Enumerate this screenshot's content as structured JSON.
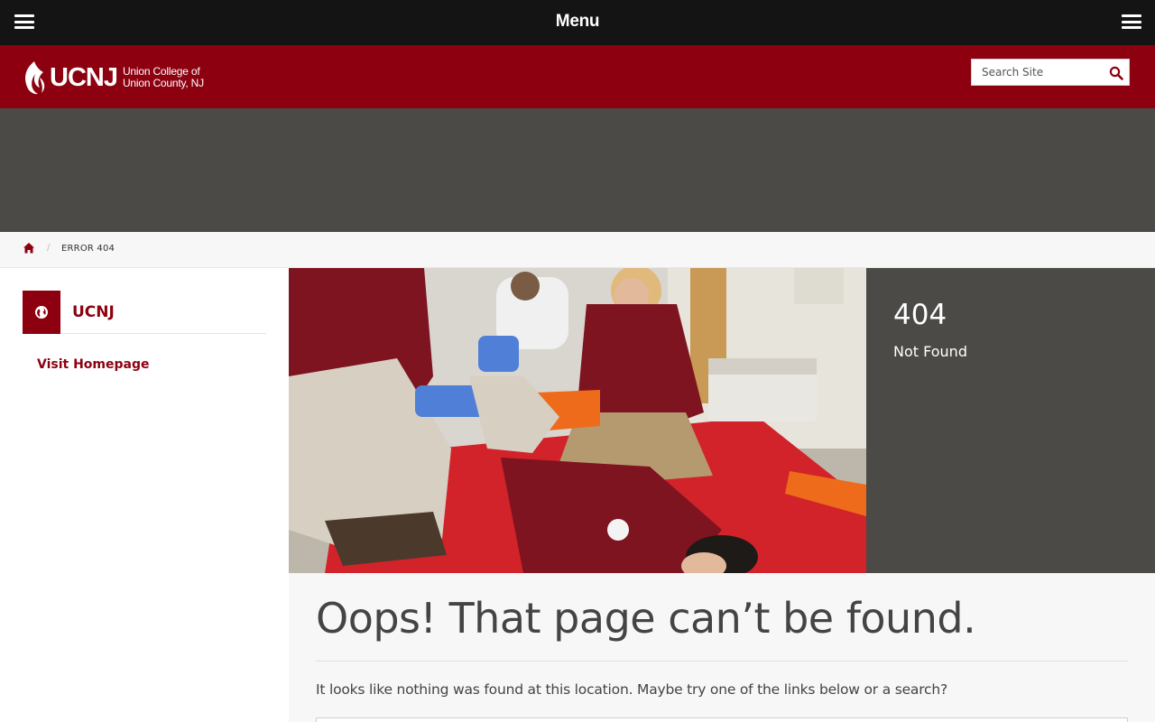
{
  "topbar": {
    "title": "Menu"
  },
  "brand": {
    "name": "UCNJ",
    "subtitle_line1": "Union College of",
    "subtitle_line2": "Union County, NJ"
  },
  "search": {
    "placeholder": "Search Site"
  },
  "breadcrumb": {
    "current": "ERROR 404"
  },
  "sidebar": {
    "title": "UCNJ",
    "link": "Visit Homepage"
  },
  "error": {
    "code": "404",
    "label": "Not Found"
  },
  "main": {
    "headline": "Oops! That page can’t be found.",
    "description": "It looks like nothing was found at this location. Maybe try one of the links below or a search?"
  },
  "colors": {
    "brand": "#8c0010",
    "topbar": "#141414",
    "panel": "#4b4a47"
  }
}
